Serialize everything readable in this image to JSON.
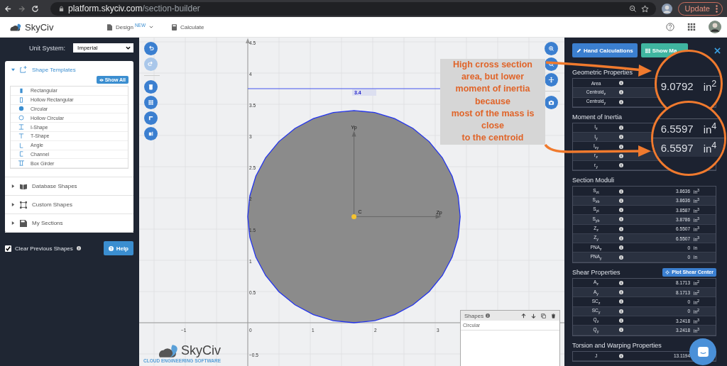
{
  "browser": {
    "url": {
      "host": "platform.skyciv.com",
      "path": "/section-builder"
    },
    "forward_disabled": true,
    "update_button": "Update"
  },
  "header": {
    "logo": "SkyCiv",
    "menu": [
      {
        "kind": "design",
        "label": "Design",
        "badge": "NEW",
        "caret": true
      },
      {
        "kind": "calculate",
        "label": "Calculate",
        "caret": false
      }
    ]
  },
  "left_panel": {
    "unit_system": {
      "label": "Unit System:",
      "value": "Imperial"
    },
    "sections": [
      {
        "kind": "templates",
        "title": "Shape Templates",
        "expanded": true,
        "action": "Show All",
        "items": [
          {
            "kind": "rect",
            "label": "Rectangular"
          },
          {
            "kind": "hollow-rect",
            "label": "Hollow Rectangular"
          },
          {
            "kind": "circle",
            "label": "Circular"
          },
          {
            "kind": "hollow-circle",
            "label": "Hollow Circular"
          },
          {
            "kind": "i",
            "label": "I-Shape"
          },
          {
            "kind": "t",
            "label": "T-Shape"
          },
          {
            "kind": "angle",
            "label": "Angle"
          },
          {
            "kind": "channel",
            "label": "Channel"
          },
          {
            "kind": "girder",
            "label": "Box Girder"
          }
        ]
      },
      {
        "kind": "database",
        "title": "Database Shapes",
        "expanded": false
      },
      {
        "kind": "custom",
        "title": "Custom Shapes",
        "expanded": false
      },
      {
        "kind": "saved",
        "title": "My Sections",
        "expanded": false
      }
    ],
    "clear_previous": {
      "label": "Clear Previous Shapes",
      "checked": true
    },
    "help_button": "Help"
  },
  "canvas": {
    "left_tools": [
      {
        "kind": "undo",
        "disabled": false
      },
      {
        "kind": "redo",
        "disabled": true
      },
      {
        "kind": "delete",
        "disabled": false
      },
      {
        "kind": "grid",
        "disabled": false
      },
      {
        "kind": "corner",
        "disabled": false
      },
      {
        "kind": "split",
        "disabled": false
      }
    ],
    "right_tools": [
      {
        "kind": "zoom-in"
      },
      {
        "kind": "zoom-out"
      },
      {
        "kind": "move"
      },
      {
        "kind": "camera"
      }
    ],
    "x_ticks": [
      "−1",
      "0",
      "1",
      "2",
      "3"
    ],
    "y_ticks": [
      "4.5",
      "4",
      "3.5",
      "3",
      "2.5",
      "2",
      "1.5",
      "1",
      "0.5",
      "−0.5"
    ],
    "shape": {
      "kind": "circle"
    },
    "dimension": "3.4",
    "axis_labels": {
      "y": "Yp",
      "z": "Zp",
      "centroid": "C"
    },
    "shapes_panel": {
      "title": "Shapes",
      "items": [
        "Circular"
      ]
    },
    "logo": {
      "name": "SkyCiv",
      "tagline": "CLOUD ENGINEERING SOFTWARE"
    }
  },
  "right_panel": {
    "buttons": [
      {
        "kind": "hand",
        "label": "Hand Calculations"
      },
      {
        "kind": "table",
        "label": "Show Ma"
      }
    ],
    "groups": [
      {
        "title": "Geometric Properties",
        "rows": [
          {
            "label": "Area"
          },
          {
            "label": "Centroid$_{z}$"
          },
          {
            "label": "Centroid$_{y}$"
          }
        ]
      },
      {
        "title": "Moment of Inertia",
        "rows": [
          {
            "label": "I$_{z}$"
          },
          {
            "label": "I$_{y}$"
          },
          {
            "label": "I$_{zy}$"
          },
          {
            "label": "r$_{z}$"
          },
          {
            "label": "r$_{y}$"
          }
        ]
      },
      {
        "title": "Section Moduli",
        "rows": [
          {
            "label": "S$_{zt}$",
            "value": "3.8636",
            "unit": "in$^{3}$"
          },
          {
            "label": "S$_{zb}$",
            "value": "3.8636",
            "unit": "in$^{3}$"
          },
          {
            "label": "S$_{yt}$",
            "value": "3.8587",
            "unit": "in$^{3}$"
          },
          {
            "label": "S$_{yb}$",
            "value": "3.8786",
            "unit": "in$^{3}$"
          },
          {
            "label": "Z$_{z}$",
            "value": "6.5507",
            "unit": "in$^{3}$"
          },
          {
            "label": "Z$_{y}$",
            "value": "6.5507",
            "unit": "in$^{3}$"
          },
          {
            "label": "PNA$_{z}$",
            "value": "0",
            "unit": "in"
          },
          {
            "label": "PNA$_{y}$",
            "value": "0",
            "unit": "in"
          }
        ]
      },
      {
        "title": "Shear Properties",
        "action": "Plot Shear Center",
        "rows": [
          {
            "label": "A$_{z}$",
            "value": "8.1713",
            "unit": "in$^{2}$"
          },
          {
            "label": "A$_{y}$",
            "value": "8.1713",
            "unit": "in$^{2}$"
          },
          {
            "label": "SC$_{z}$",
            "value": "0",
            "unit": "in$^{2}$"
          },
          {
            "label": "SC$_{y}$",
            "value": "0",
            "unit": "in$^{2}$"
          },
          {
            "label": "Q$_{z}$",
            "value": "3.2418",
            "unit": "in$^{3}$"
          },
          {
            "label": "Q$_{y}$",
            "value": "3.2418",
            "unit": "in$^{3}$"
          }
        ]
      },
      {
        "title": "Torsion and Warping Properties",
        "rows": [
          {
            "label": "J",
            "value": "13.1194"
          }
        ]
      }
    ]
  },
  "annotation": {
    "note": [
      "High cross section",
      "area, but lower",
      "moment of inertia",
      "because",
      "most of the mass is",
      "close",
      "to the centroid"
    ],
    "magnifiers": [
      {
        "readings": [
          {
            "value": "9.0792",
            "unit": "in$^{2}$"
          }
        ]
      },
      {
        "readings": [
          {
            "value": "6.5597",
            "unit": "in$^{4}$"
          },
          {
            "value": "6.5597",
            "unit": "in$^{4}$"
          }
        ]
      }
    ]
  }
}
